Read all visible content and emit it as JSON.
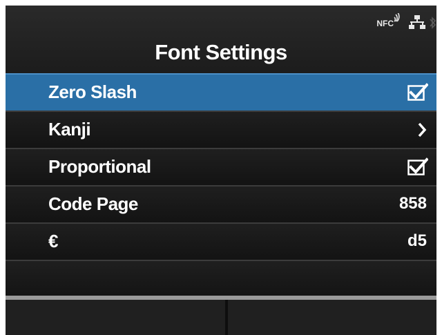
{
  "status": {
    "nfc_label": "NFC"
  },
  "header": {
    "title": "Font Settings"
  },
  "menu": [
    {
      "label": "Zero Slash",
      "type": "checkbox",
      "checked": true,
      "selected": true
    },
    {
      "label": "Kanji",
      "type": "submenu"
    },
    {
      "label": "Proportional",
      "type": "checkbox",
      "checked": true
    },
    {
      "label": "Code Page",
      "type": "value",
      "value": "858"
    },
    {
      "label": "€",
      "type": "value",
      "value": "d5"
    }
  ],
  "colors": {
    "highlight": "#2a6fa6",
    "background": "#161616",
    "text": "#ffffff"
  },
  "icons": [
    "nfc-icon",
    "network-icon",
    "bluetooth-icon",
    "checkmark-icon",
    "chevron-right-icon"
  ]
}
